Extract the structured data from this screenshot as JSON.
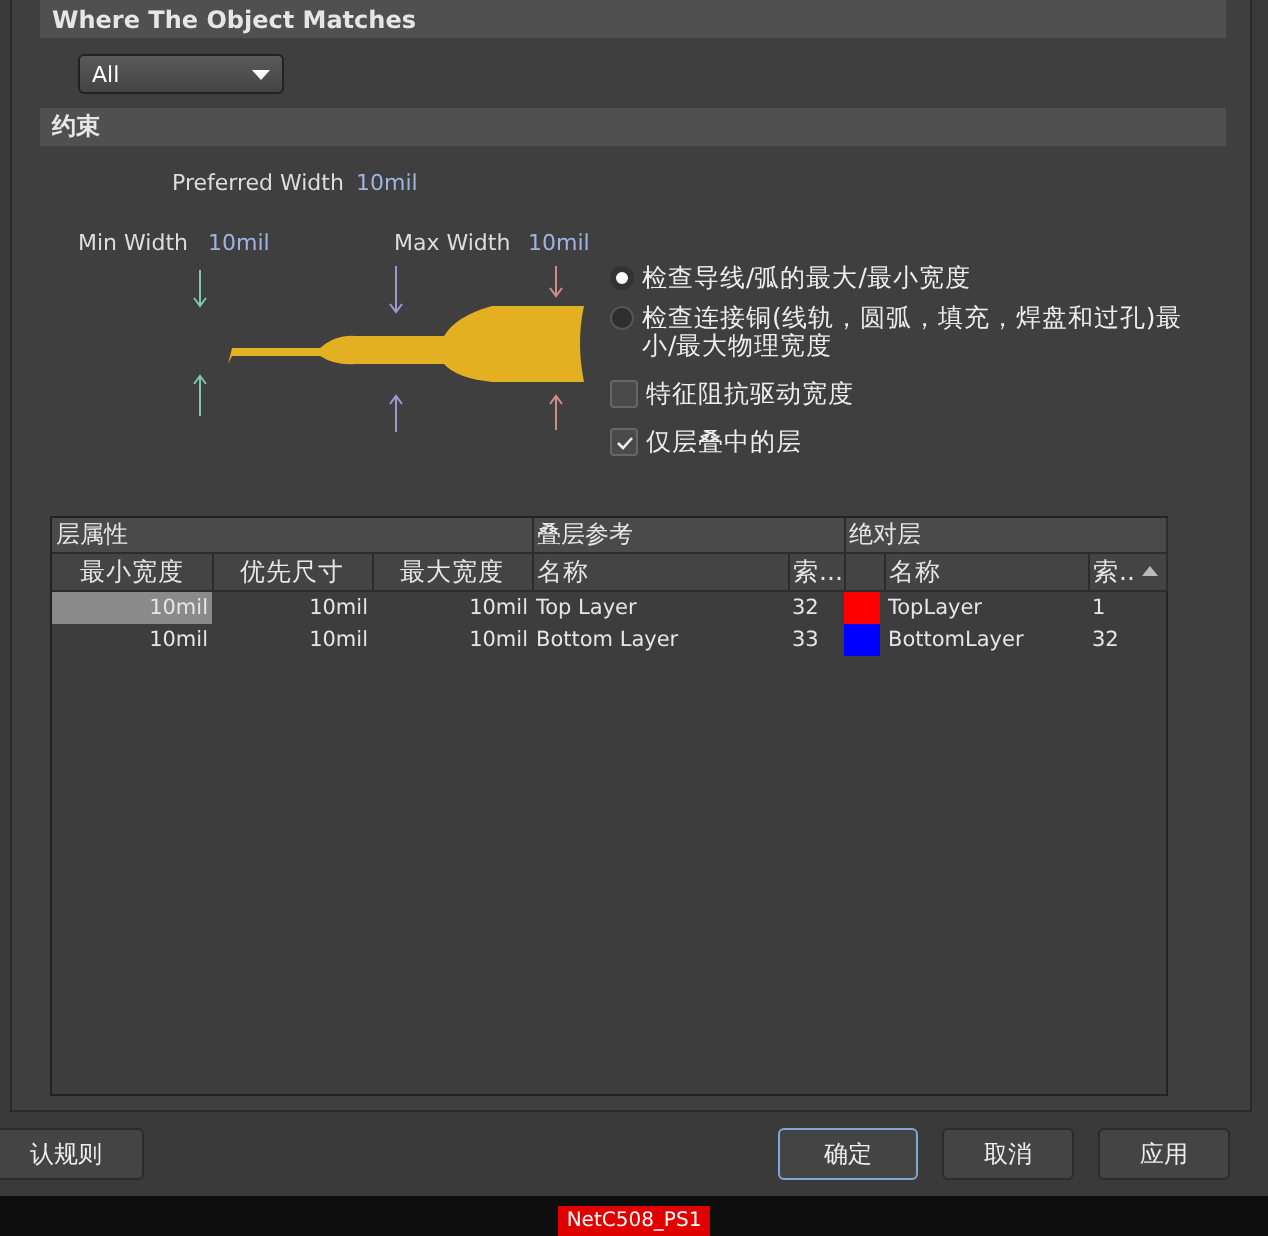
{
  "filter_section": {
    "title": "Where The Object Matches",
    "dropdown": "All"
  },
  "constraints": {
    "title": "约束",
    "preferred_width": {
      "label": "Preferred Width",
      "value": "10mil"
    },
    "min_width": {
      "label": "Min Width",
      "value": "10mil"
    },
    "max_width": {
      "label": "Max Width",
      "value": "10mil"
    },
    "options": [
      {
        "kind": "radio",
        "label": "检查导线/弧的最大/最小宽度",
        "selected": true
      },
      {
        "kind": "radio",
        "label": "检查连接铜(线轨，圆弧，填充，焊盘和过孔)最小/最大物理宽度",
        "selected": false
      },
      {
        "kind": "checkbox",
        "label": "特征阻抗驱动宽度",
        "checked": false
      },
      {
        "kind": "checkbox",
        "label": "仅层叠中的层",
        "checked": true
      }
    ]
  },
  "layer_table": {
    "groups": [
      "层属性",
      "叠层参考",
      "绝对层"
    ],
    "columns": [
      "最小宽度",
      "优先尺寸",
      "最大宽度",
      "名称",
      "索...",
      "名称",
      "索.."
    ],
    "rows": [
      {
        "min": "10mil",
        "pref": "10mil",
        "max": "10mil",
        "stack_name": "Top Layer",
        "stack_index": "32",
        "color": "#ff0000",
        "layer_name": "TopLayer",
        "layer_index": "1",
        "selected": true
      },
      {
        "min": "10mil",
        "pref": "10mil",
        "max": "10mil",
        "stack_name": "Bottom Layer",
        "stack_index": "33",
        "color": "#0000ff",
        "layer_name": "BottomLayer",
        "layer_index": "32",
        "selected": false
      }
    ]
  },
  "buttons": [
    {
      "label": "认规则",
      "default": false
    },
    {
      "label": "确定",
      "default": true
    },
    {
      "label": "取消",
      "default": false
    },
    {
      "label": "应用",
      "default": false
    }
  ],
  "canvas_label": "NetC508_PS1"
}
